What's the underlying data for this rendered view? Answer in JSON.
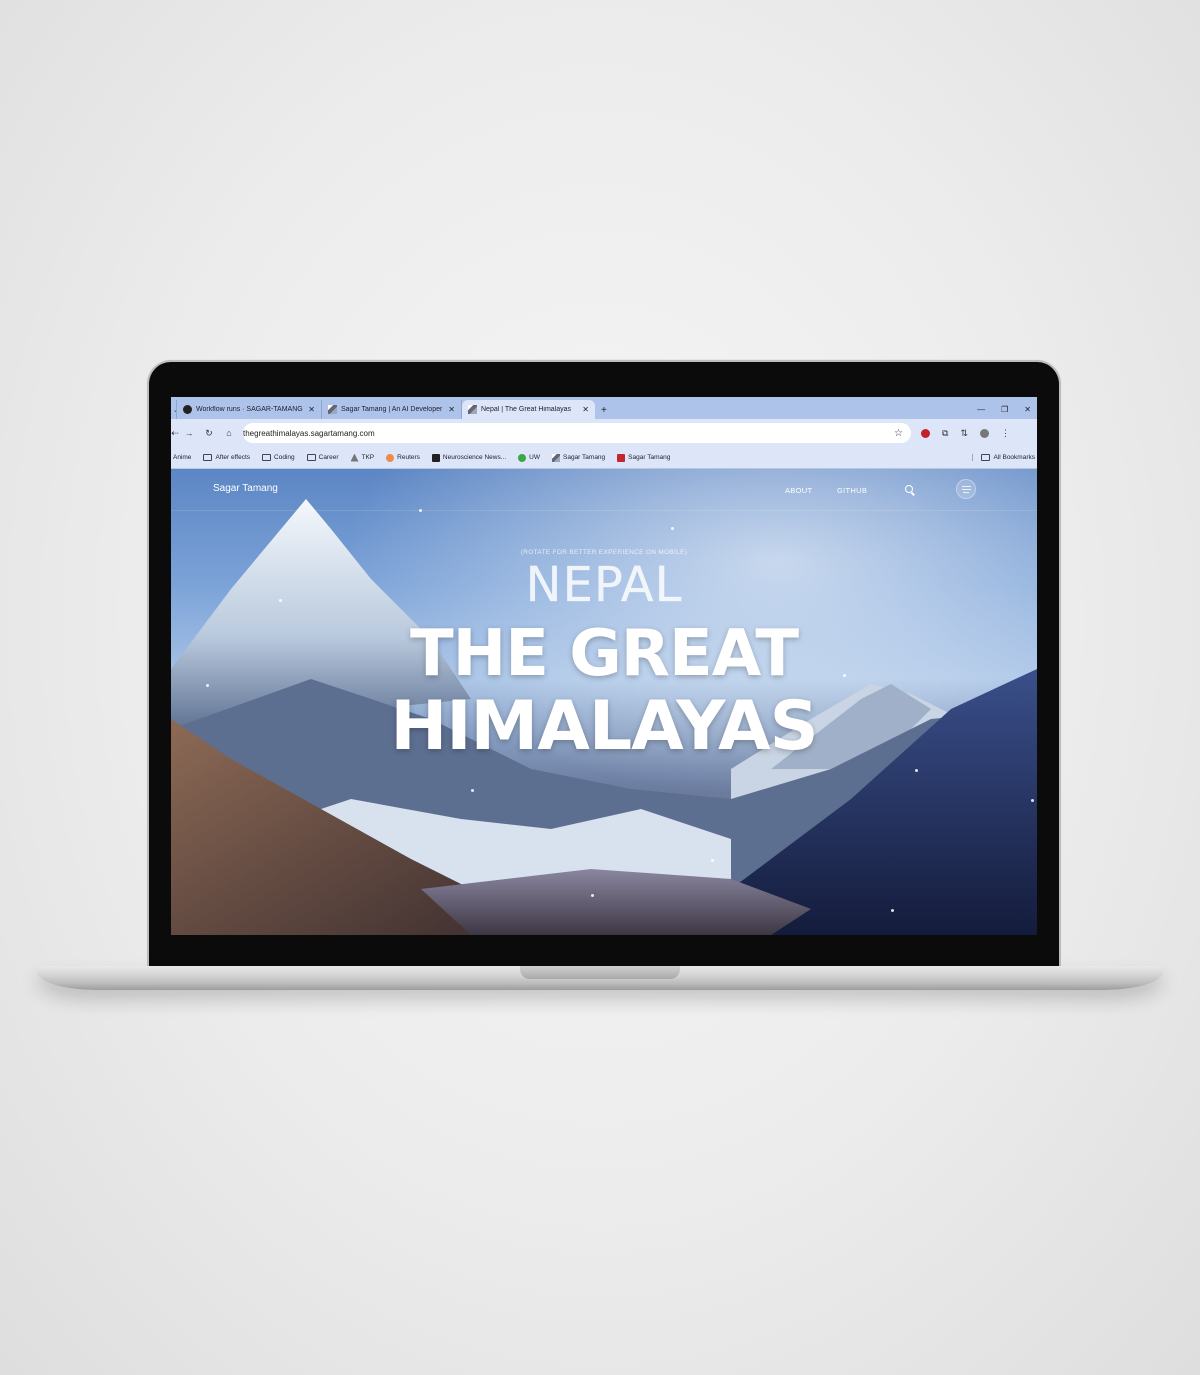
{
  "browser": {
    "tabs": [
      {
        "title": "Workflow runs · SAGAR-TAMANG",
        "favicon": "github-icon",
        "active": false
      },
      {
        "title": "Sagar Tamang | An AI Developer",
        "favicon": "mountain-icon",
        "active": false
      },
      {
        "title": "Nepal | The Great Himalayas",
        "favicon": "mountain-icon",
        "active": true
      }
    ],
    "url": "thegreathimalayas.sagartamang.com",
    "bookmarks": [
      {
        "label": "Anime",
        "icon": "folder-icon"
      },
      {
        "label": "After effects",
        "icon": "folder-icon"
      },
      {
        "label": "Coding",
        "icon": "folder-icon"
      },
      {
        "label": "Career",
        "icon": "folder-icon"
      },
      {
        "label": "TKP",
        "icon": "tkp-icon"
      },
      {
        "label": "Reuters",
        "icon": "reuters-icon"
      },
      {
        "label": "Neuroscience News...",
        "icon": "neuroscience-icon"
      },
      {
        "label": "UW",
        "icon": "uw-icon"
      },
      {
        "label": "Sagar Tamang",
        "icon": "mountain-icon"
      },
      {
        "label": "Sagar Tamang",
        "icon": "profile-icon"
      }
    ],
    "all_bookmarks": "All Bookmarks"
  },
  "site": {
    "brand": "Sagar Tamang",
    "nav": {
      "about": "ABOUT",
      "github": "GITHUB"
    },
    "note": "(ROTATE FOR BETTER EXPERIENCE ON MOBILE)",
    "heading_small": "NEPAL",
    "heading_line1": "THE GREAT",
    "heading_line2": "HIMALAYAS"
  },
  "colors": {
    "tabbar": "#aec3ea",
    "toolbar": "#dde6f8",
    "sky": "#7ca3d8"
  }
}
